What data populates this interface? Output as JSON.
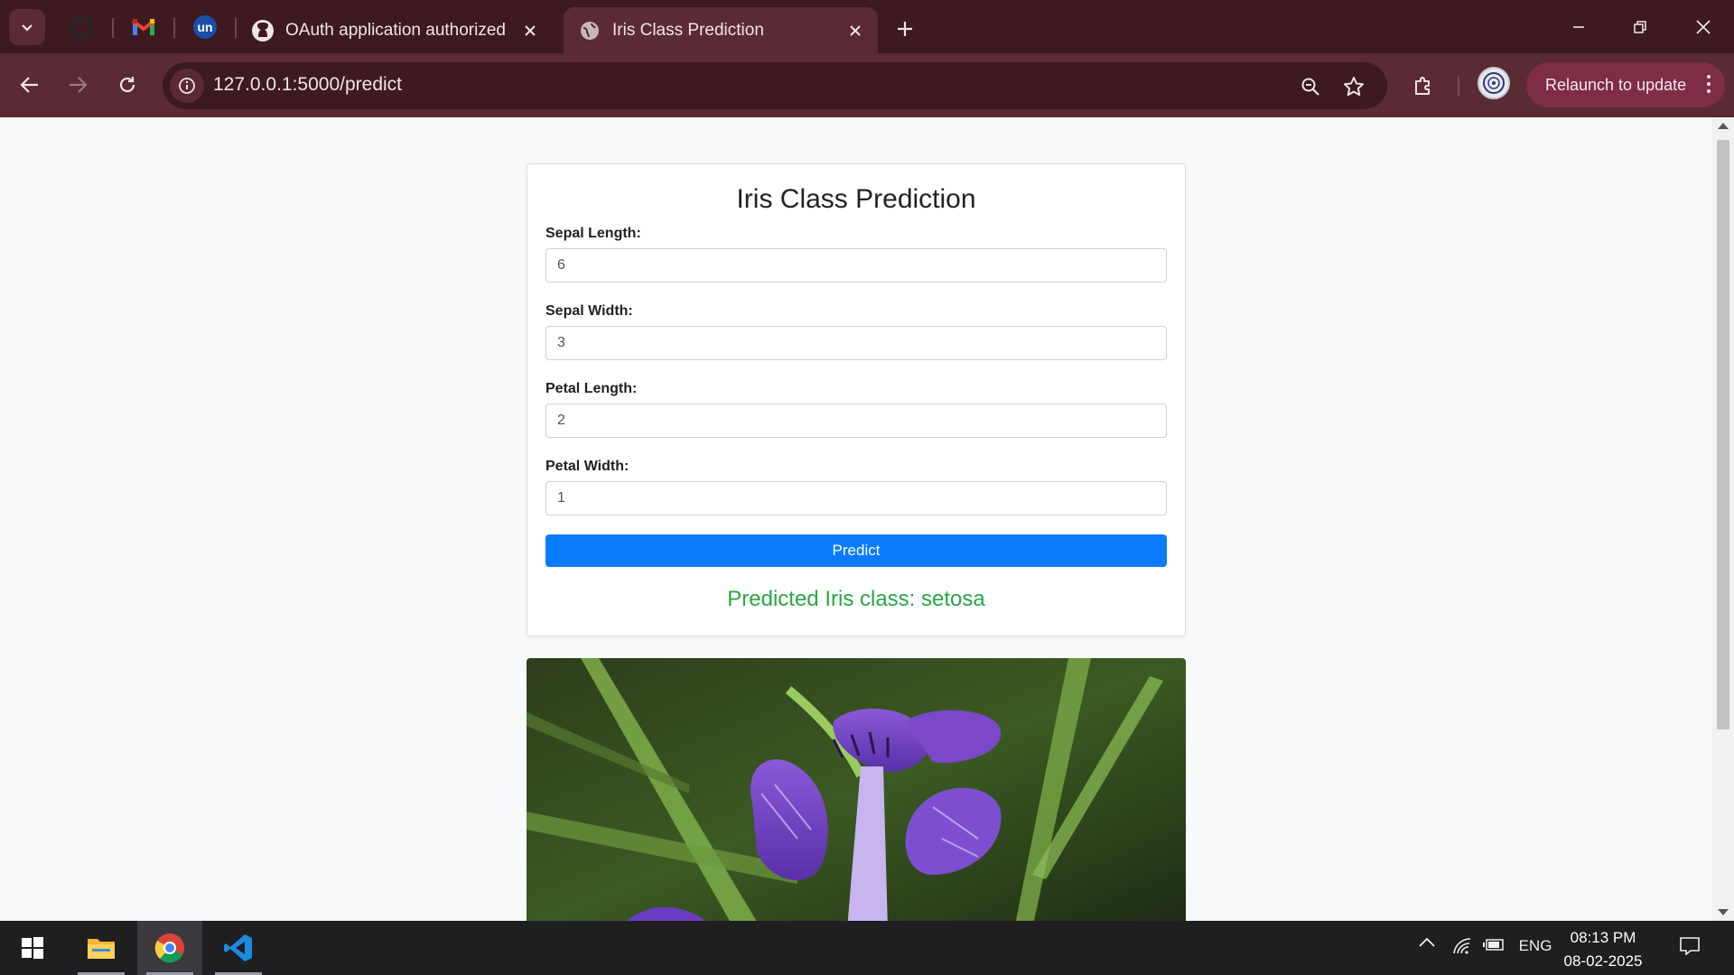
{
  "browser": {
    "tabs": [
      {
        "title": "OAuth application authorized",
        "icon": "github-icon",
        "active": false
      },
      {
        "title": "Iris Class Prediction",
        "icon": "globe-icon",
        "active": true
      }
    ],
    "pinned_tabs": [
      "github-circle-icon",
      "gmail-icon",
      "unstop-icon"
    ],
    "url": "127.0.0.1:5000/predict",
    "relaunch_label": "Relaunch to update",
    "colors": {
      "frame": "#3c1a20",
      "toolbar": "#5a2b34",
      "relaunch": "#7e2d45"
    }
  },
  "page": {
    "title": "Iris Class Prediction",
    "fields": [
      {
        "label": "Sepal Length:",
        "value": "6"
      },
      {
        "label": "Sepal Width:",
        "value": "3"
      },
      {
        "label": "Petal Length:",
        "value": "2"
      },
      {
        "label": "Petal Width:",
        "value": "1"
      }
    ],
    "button_label": "Predict",
    "result": "Predicted Iris class: setosa",
    "colors": {
      "button": "#0a7bfc",
      "result": "#28a745"
    },
    "image": "iris-flower-photo"
  },
  "taskbar": {
    "apps": [
      "windows-start-icon",
      "file-explorer-icon",
      "chrome-icon",
      "vscode-icon"
    ],
    "tray": {
      "language": "ENG",
      "time": "08:13 PM",
      "date": "08-02-2025"
    }
  }
}
